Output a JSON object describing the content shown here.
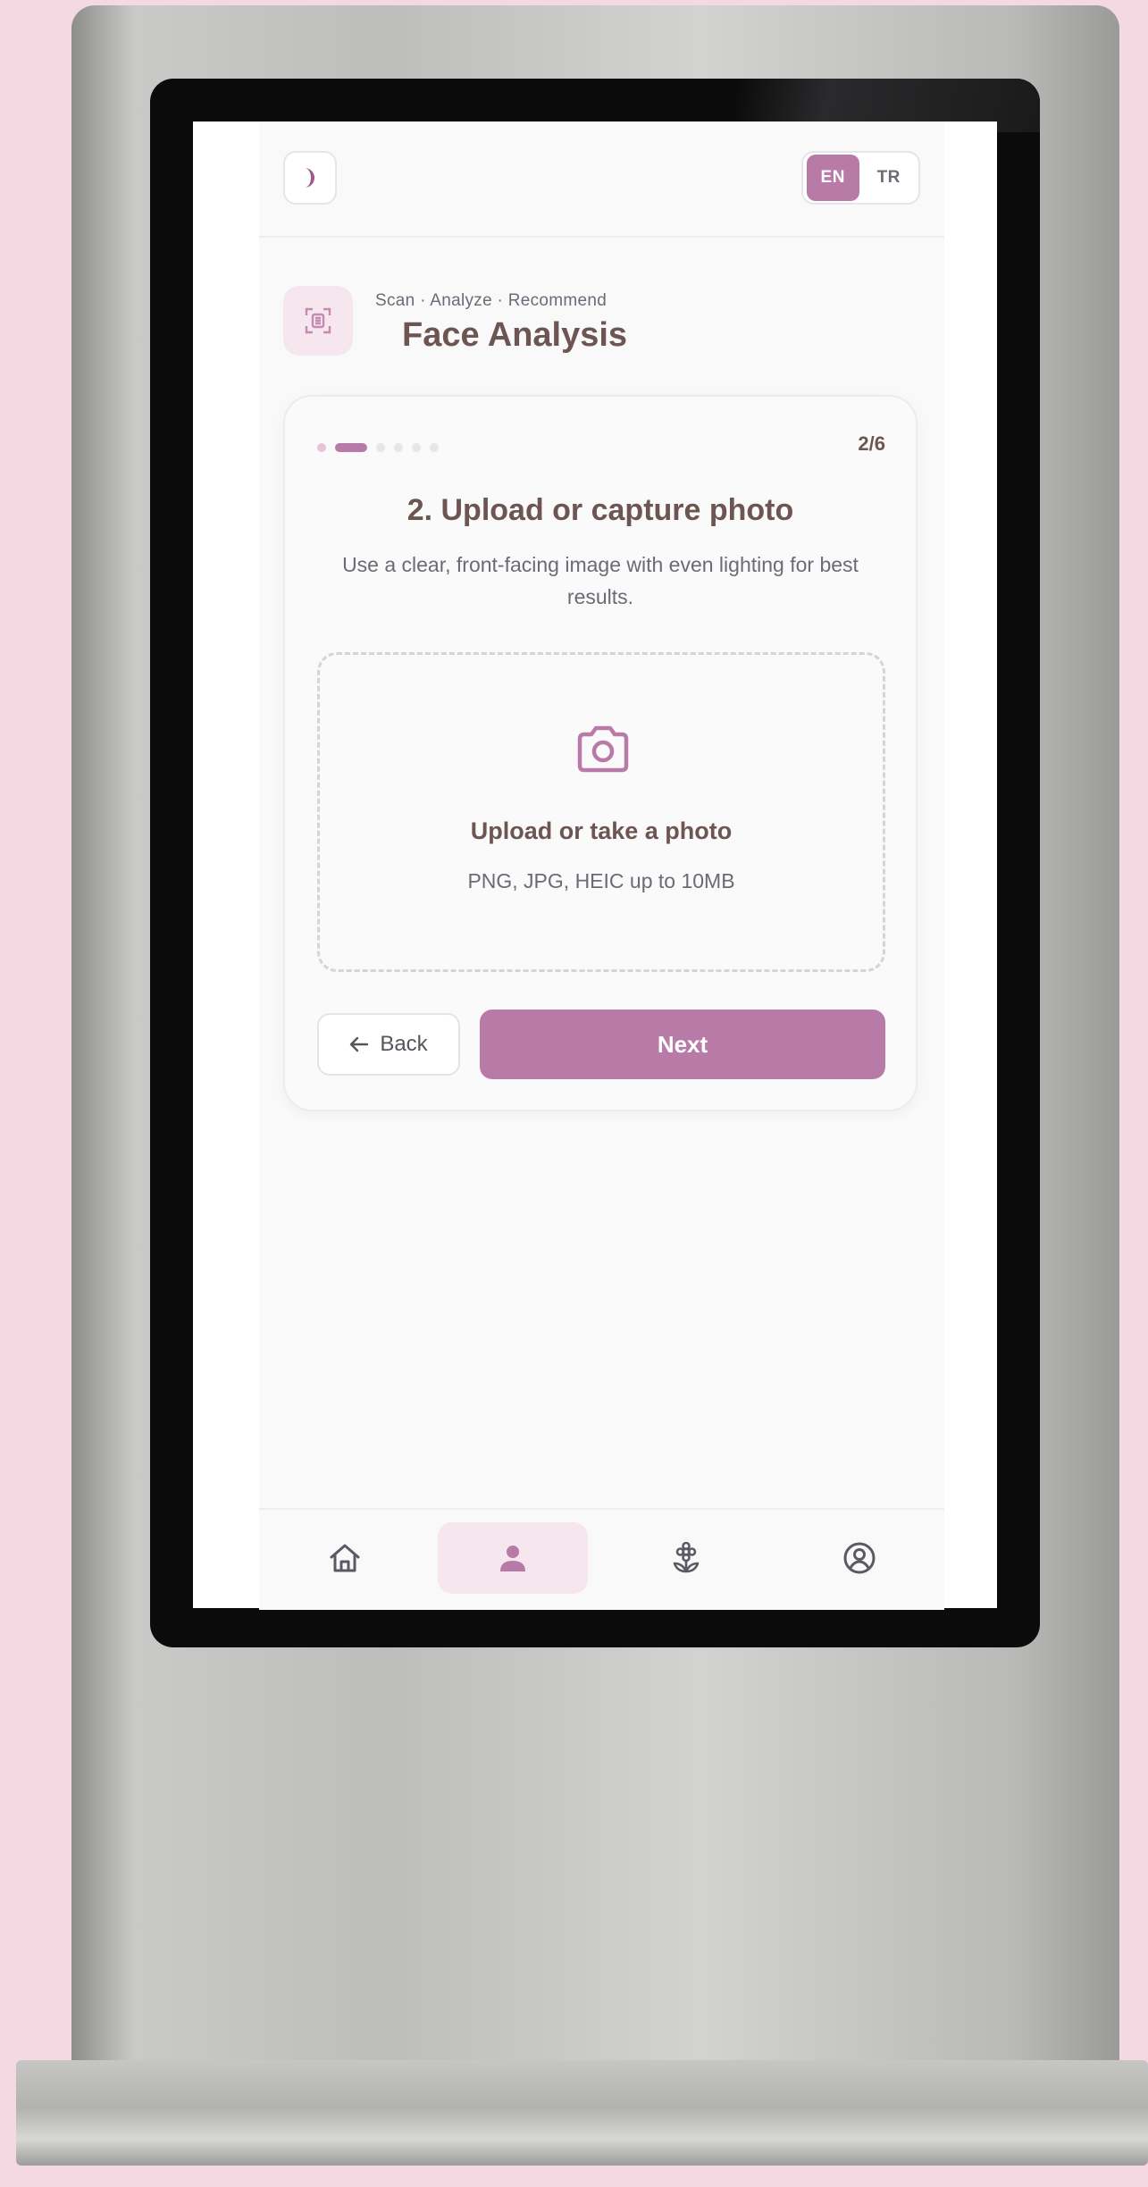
{
  "colors": {
    "accent": "#b87aa6",
    "accent_soft": "#f6e6ee",
    "title_brown": "#6d5552",
    "muted": "#6b6b75"
  },
  "topbar": {
    "theme_icon": "moon-icon",
    "languages": [
      {
        "label": "EN",
        "active": true
      },
      {
        "label": "TR",
        "active": false
      }
    ]
  },
  "header": {
    "icon": "face-scan-icon",
    "kicker": "Scan · Analyze · Recommend",
    "title": "Face Analysis"
  },
  "wizard": {
    "current_step": 2,
    "total_steps": 6,
    "step_counter": "2/6",
    "step_title": "2. Upload or capture photo",
    "step_description": "Use a clear, front-facing image with even lighting for best results.",
    "upload": {
      "icon": "camera-icon",
      "title": "Upload or take a photo",
      "subtitle": "PNG, JPG, HEIC up to 10MB"
    },
    "back_icon": "arrow-left-icon",
    "back_label": "Back",
    "next_label": "Next"
  },
  "bottom_nav": [
    {
      "icon": "home-icon",
      "active": false
    },
    {
      "icon": "user-icon",
      "active": true
    },
    {
      "icon": "flower-icon",
      "active": false
    },
    {
      "icon": "profile-circle-icon",
      "active": false
    }
  ]
}
